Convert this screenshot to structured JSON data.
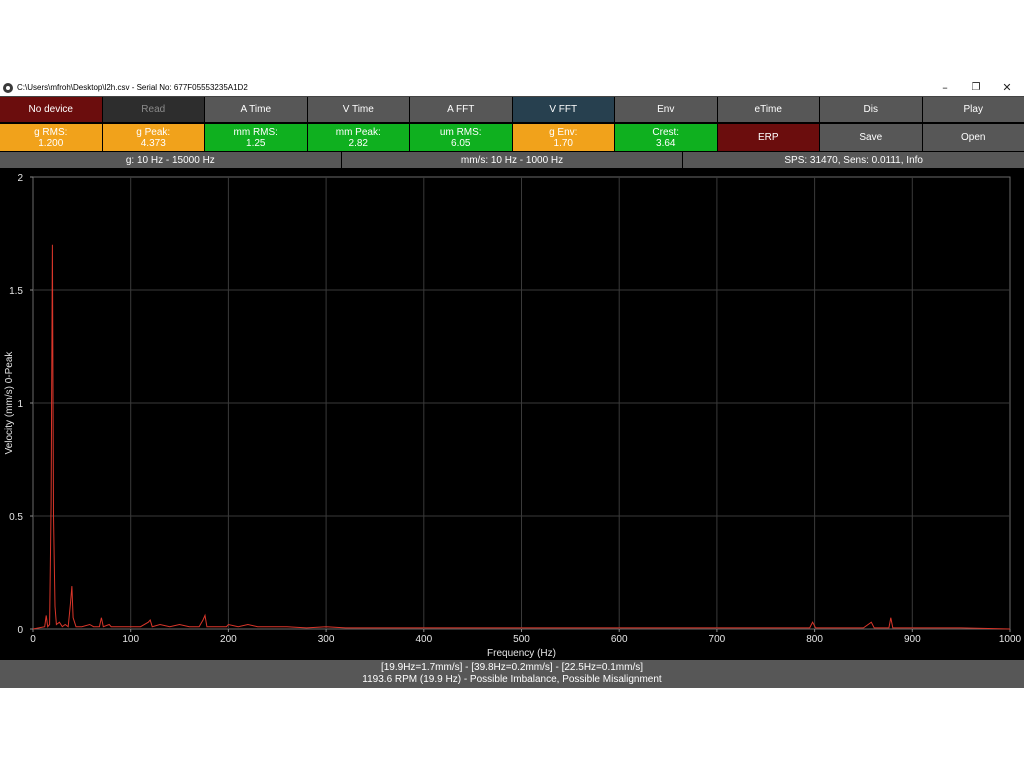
{
  "window": {
    "title": "C:\\Users\\mfroh\\Desktop\\l2h.csv - Serial No: 677F05553235A1D2",
    "minimize": "–",
    "restore": "❐",
    "close": "✕"
  },
  "toolbar": [
    {
      "id": "device",
      "label": "No device",
      "style": "darkred"
    },
    {
      "id": "read",
      "label": "Read",
      "style": "disabled"
    },
    {
      "id": "a-time",
      "label": "A Time",
      "style": "gray"
    },
    {
      "id": "v-time",
      "label": "V Time",
      "style": "gray"
    },
    {
      "id": "a-fft",
      "label": "A FFT",
      "style": "gray"
    },
    {
      "id": "v-fft",
      "label": "V FFT",
      "style": "active"
    },
    {
      "id": "env",
      "label": "Env",
      "style": "gray"
    },
    {
      "id": "etime",
      "label": "eTime",
      "style": "gray"
    },
    {
      "id": "dis",
      "label": "Dis",
      "style": "gray"
    },
    {
      "id": "play",
      "label": "Play",
      "style": "gray"
    }
  ],
  "metrics": [
    {
      "id": "g-rms",
      "label": "g RMS:",
      "value": "1.200",
      "style": "orange"
    },
    {
      "id": "g-peak",
      "label": "g Peak:",
      "value": "4.373",
      "style": "orange"
    },
    {
      "id": "mm-rms",
      "label": "mm RMS:",
      "value": "1.25",
      "style": "green"
    },
    {
      "id": "mm-peak",
      "label": "mm Peak:",
      "value": "2.82",
      "style": "green"
    },
    {
      "id": "um-rms",
      "label": "um RMS:",
      "value": "6.05",
      "style": "green"
    },
    {
      "id": "g-env",
      "label": "g Env:",
      "value": "1.70",
      "style": "orange"
    },
    {
      "id": "crest",
      "label": "Crest:",
      "value": "3.64",
      "style": "green"
    }
  ],
  "actions": [
    {
      "id": "erp",
      "label": "ERP",
      "style": "darkred"
    },
    {
      "id": "save",
      "label": "Save",
      "style": "gray"
    },
    {
      "id": "open",
      "label": "Open",
      "style": "gray"
    }
  ],
  "info_bar": {
    "g_range": "g: 10 Hz - 15000 Hz",
    "mms_range": "mm/s: 10 Hz - 1000 Hz",
    "sps": "SPS: 31470, Sens: 0.0111, Info"
  },
  "colors": {
    "orange": "#f1a21b",
    "green": "#0fb01f",
    "darkred": "#6b0d0d",
    "gray": "#575757",
    "active": "#27404f",
    "trace": "#d9362a",
    "grid": "#3a3a3a"
  },
  "chart_data": {
    "type": "line",
    "title": "",
    "xlabel": "Frequency (Hz)",
    "ylabel": "Velocity (mm/s) 0-Peak",
    "xlim": [
      0,
      1000
    ],
    "ylim": [
      0,
      2
    ],
    "x_ticks": [
      0,
      100,
      200,
      300,
      400,
      500,
      600,
      700,
      800,
      900,
      1000
    ],
    "y_ticks": [
      0,
      0.5,
      1,
      1.5,
      2
    ],
    "y_tick_labels": [
      "0",
      "0.5",
      "1",
      "1.5",
      "2"
    ],
    "grid": true,
    "series": [
      {
        "color": "#d9362a",
        "points": [
          [
            0,
            0
          ],
          [
            12,
            0.01
          ],
          [
            13.5,
            0.06
          ],
          [
            15,
            0.01
          ],
          [
            17,
            0.02
          ],
          [
            18.5,
            0.55
          ],
          [
            19.9,
            1.7
          ],
          [
            21,
            0.5
          ],
          [
            22.5,
            0.1
          ],
          [
            24,
            0.02
          ],
          [
            27,
            0.03
          ],
          [
            30,
            0.01
          ],
          [
            33,
            0.02
          ],
          [
            36,
            0.01
          ],
          [
            38.5,
            0.12
          ],
          [
            39.8,
            0.19
          ],
          [
            41,
            0.05
          ],
          [
            44,
            0.01
          ],
          [
            50,
            0.01
          ],
          [
            58,
            0.02
          ],
          [
            62,
            0.01
          ],
          [
            68,
            0.01
          ],
          [
            70,
            0.05
          ],
          [
            72,
            0.01
          ],
          [
            78,
            0.02
          ],
          [
            80,
            0.01
          ],
          [
            90,
            0.01
          ],
          [
            100,
            0.01
          ],
          [
            110,
            0.01
          ],
          [
            118,
            0.03
          ],
          [
            120,
            0.04
          ],
          [
            122,
            0.01
          ],
          [
            130,
            0.02
          ],
          [
            140,
            0.01
          ],
          [
            150,
            0.02
          ],
          [
            160,
            0.01
          ],
          [
            170,
            0.01
          ],
          [
            174,
            0.04
          ],
          [
            176,
            0.06
          ],
          [
            178,
            0.01
          ],
          [
            190,
            0.01
          ],
          [
            198,
            0.01
          ],
          [
            200,
            0.02
          ],
          [
            210,
            0.01
          ],
          [
            220,
            0.02
          ],
          [
            230,
            0.01
          ],
          [
            240,
            0.01
          ],
          [
            260,
            0.01
          ],
          [
            280,
            0.005
          ],
          [
            300,
            0.01
          ],
          [
            320,
            0.005
          ],
          [
            350,
            0.005
          ],
          [
            400,
            0.005
          ],
          [
            450,
            0.005
          ],
          [
            500,
            0.005
          ],
          [
            550,
            0.005
          ],
          [
            600,
            0.005
          ],
          [
            650,
            0.005
          ],
          [
            700,
            0.005
          ],
          [
            750,
            0.005
          ],
          [
            795,
            0.005
          ],
          [
            798,
            0.03
          ],
          [
            801,
            0.005
          ],
          [
            850,
            0.005
          ],
          [
            858,
            0.03
          ],
          [
            861,
            0.005
          ],
          [
            876,
            0.005
          ],
          [
            878,
            0.05
          ],
          [
            880,
            0.005
          ],
          [
            900,
            0.005
          ],
          [
            950,
            0.005
          ],
          [
            1000,
            0
          ]
        ]
      }
    ]
  },
  "footer": {
    "peaks": "[19.9Hz=1.7mm/s] - [39.8Hz=0.2mm/s] - [22.5Hz=0.1mm/s]",
    "diagnosis": "1193.6 RPM (19.9 Hz) - Possible Imbalance, Possible Misalignment"
  }
}
